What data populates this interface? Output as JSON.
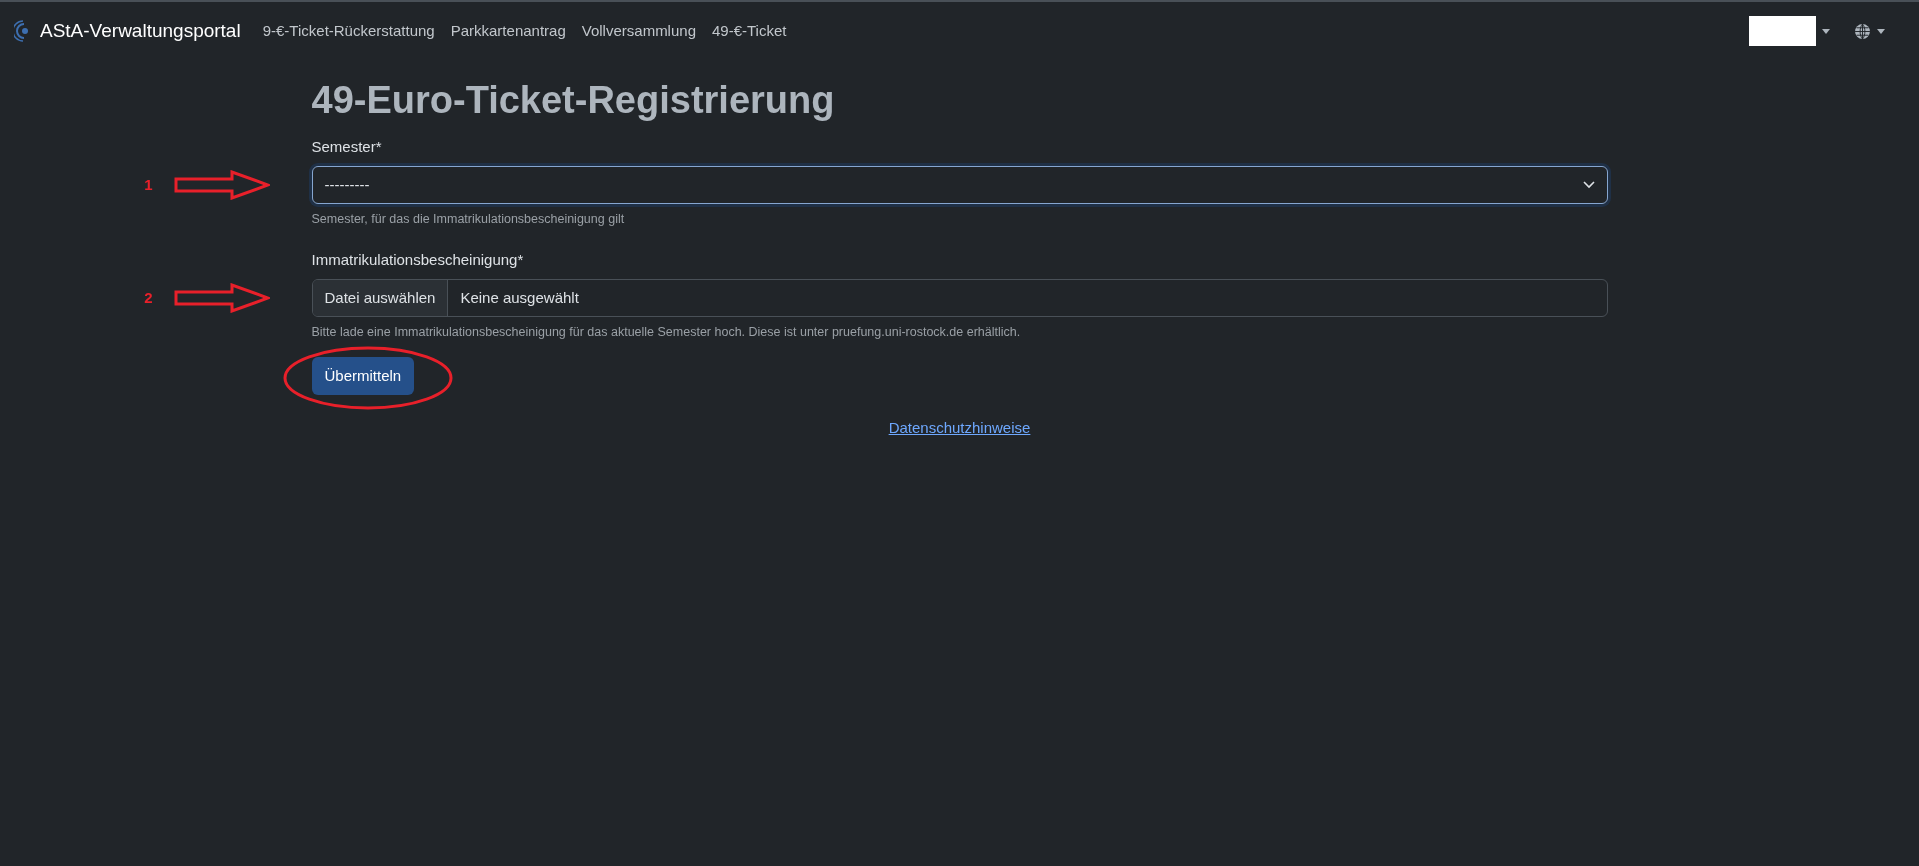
{
  "navbar": {
    "brand": "AStA-Verwaltungsportal",
    "links": [
      {
        "label": "9-€-Ticket-Rückerstattung"
      },
      {
        "label": "Parkkartenantrag"
      },
      {
        "label": "Vollversammlung"
      },
      {
        "label": "49-€-Ticket"
      }
    ]
  },
  "page": {
    "title": "49-Euro-Ticket-Registrierung",
    "semester": {
      "label": "Semester*",
      "value": "---------",
      "help": "Semester, für das die Immatrikulationsbescheinigung gilt"
    },
    "certificate": {
      "label": "Immatrikulationsbescheinigung*",
      "button": "Datei auswählen",
      "value": "Keine ausgewählt",
      "help": "Bitte lade eine Immatrikulationsbescheinigung für das aktuelle Semester hoch. Diese ist unter pruefung.uni-rostock.de erhältlich."
    },
    "submit": "Übermitteln",
    "privacy_link": "Datenschutzhinweise"
  },
  "annotations": [
    {
      "number": "1"
    },
    {
      "number": "2"
    }
  ]
}
